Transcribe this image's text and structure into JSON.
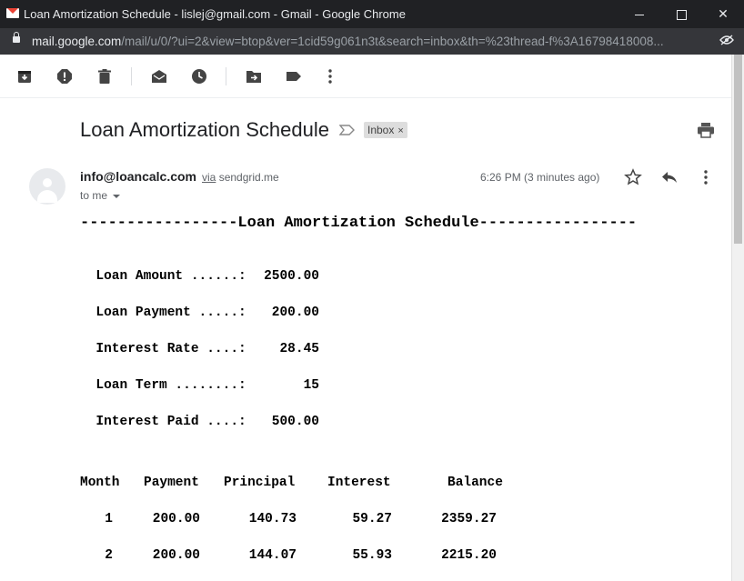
{
  "window": {
    "title": "Loan Amortization Schedule - lislej@gmail.com - Gmail - Google Chrome",
    "url_host": "mail.google.com",
    "url_rest": "/mail/u/0/?ui=2&view=btop&ver=1cid59g061n3t&search=inbox&th=%23thread-f%3A16798418008..."
  },
  "toolbar": {
    "icons": [
      "archive-icon",
      "report-spam-icon",
      "delete-icon",
      "mark-unread-icon",
      "snooze-icon",
      "move-to-icon",
      "label-icon",
      "more-vert-icon"
    ]
  },
  "email": {
    "subject": "Loan Amortization Schedule",
    "label": "Inbox",
    "label_close": "×",
    "sender": "info@loancalc.com",
    "via": "via",
    "via_domain": "sendgrid.me",
    "to": "to me",
    "time": "6:26 PM (3 minutes ago)"
  },
  "body": {
    "heading": "-----------------Loan Amortization Schedule-----------------",
    "summary": [
      {
        "label": "Loan Amount ......:",
        "value": "2500.00"
      },
      {
        "label": "Loan Payment .....:",
        "value": "200.00"
      },
      {
        "label": "Interest Rate ....:",
        "value": "28.45"
      },
      {
        "label": "Loan Term ........:",
        "value": "15"
      },
      {
        "label": "Interest Paid ....:",
        "value": "500.00"
      }
    ],
    "table": {
      "headers": [
        "Month",
        "Payment",
        "Principal",
        "Interest",
        "Balance"
      ],
      "rows": [
        [
          "1",
          "200.00",
          "140.73",
          "59.27",
          "2359.27"
        ],
        [
          "2",
          "200.00",
          "144.07",
          "55.93",
          "2215.20"
        ]
      ]
    }
  },
  "colors": {
    "titlebar": "#202124",
    "addressbar": "#35363a",
    "gmail_red": "#ea4335"
  }
}
